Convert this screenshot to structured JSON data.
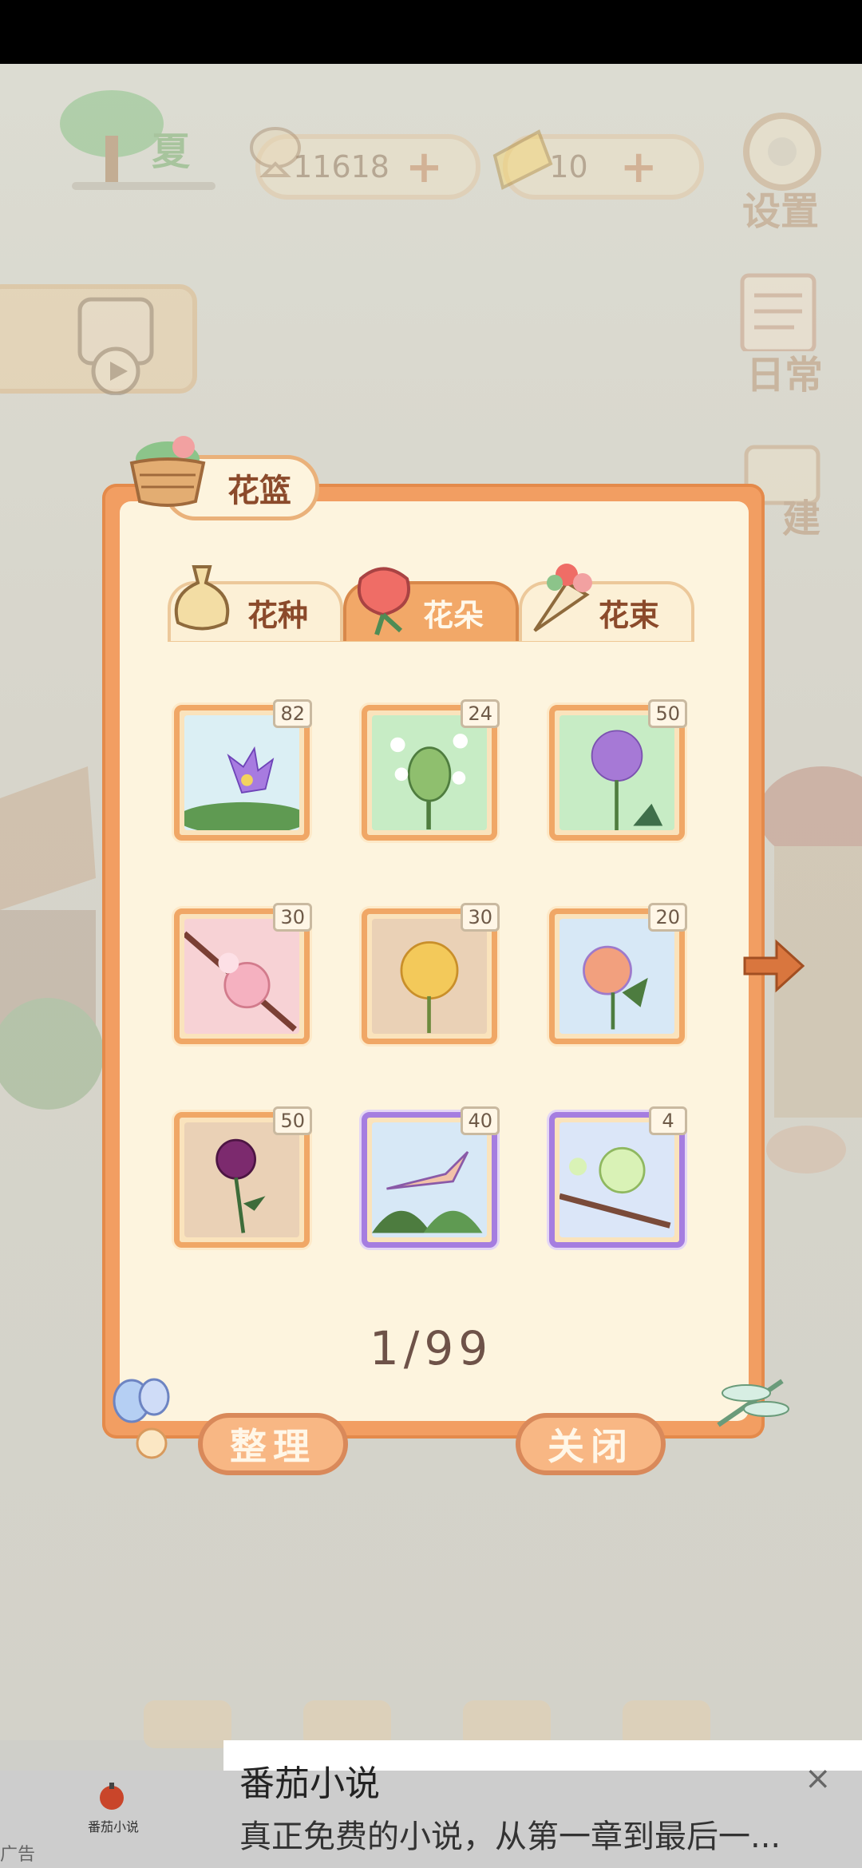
{
  "hud": {
    "season_label": "夏",
    "fish_count": "11618",
    "cheese_count": "10",
    "settings_label": "设置",
    "daily_label": "日常",
    "build_label": "建"
  },
  "modal": {
    "title": "花篮",
    "tabs": [
      {
        "label": "花种",
        "icon": "seed-bag-icon",
        "active": false
      },
      {
        "label": "花朵",
        "icon": "rose-icon",
        "active": true
      },
      {
        "label": "花束",
        "icon": "bouquet-icon",
        "active": false
      }
    ],
    "items": [
      {
        "name": "water-lily",
        "count": "82",
        "frame": "orange"
      },
      {
        "name": "artichoke-flower",
        "count": "24",
        "frame": "orange"
      },
      {
        "name": "allium",
        "count": "50",
        "frame": "orange"
      },
      {
        "name": "pink-camellia",
        "count": "30",
        "frame": "orange"
      },
      {
        "name": "golden-chrysanthemum",
        "count": "30",
        "frame": "orange"
      },
      {
        "name": "rainbow-rose",
        "count": "20",
        "frame": "orange"
      },
      {
        "name": "purple-rose",
        "count": "50",
        "frame": "orange"
      },
      {
        "name": "bird-of-paradise",
        "count": "40",
        "frame": "purple"
      },
      {
        "name": "green-plum-blossom",
        "count": "4",
        "frame": "purple"
      }
    ],
    "page_indicator": "1/99",
    "sort_button": "整理",
    "close_button": "关闭"
  },
  "ad": {
    "title": "番茄小说",
    "description": "真正免费的小说，从第一章到最后一...",
    "logo_label": "番茄小说",
    "tag": "广告",
    "close": "×"
  },
  "colors": {
    "modal_border": "#f29e62",
    "modal_bg": "#fdf4de",
    "text_brown": "#8b4a2b",
    "purple_frame": "#a57de0"
  }
}
